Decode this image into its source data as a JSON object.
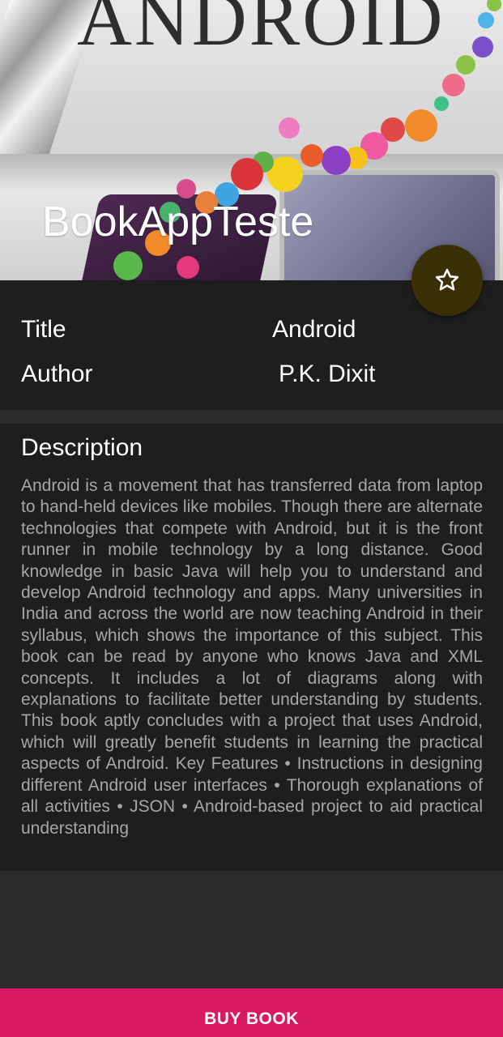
{
  "header": {
    "cover_text": "ANDROID",
    "app_title": "BookAppTeste",
    "favorite_icon": "star-outline-icon"
  },
  "book": {
    "title_label": "Title",
    "title_value": "Android",
    "author_label": "Author",
    "author_value": "P.K. Dixit"
  },
  "description": {
    "heading": "Description",
    "text": "Android is a movement that has transferred data from laptop to hand-held devices like mobiles. Though there are alternate technologies that compete with Android, but it is the front runner in mobile technology by a long distance. Good knowledge in basic Java will help you to understand and develop Android technology and apps. Many universities in India and across the world are now teaching Android in their syllabus, which shows the importance of this subject. This book can be read by anyone who knows Java and XML concepts. It includes a lot of diagrams along with explanations to facilitate better understanding by students. This book aptly concludes with a project that uses Android, which will greatly benefit students in learning the practical aspects of Android. Key Features • Instructions in designing different Android user interfaces • Thorough explanations of all activities • JSON • Android-based project to aid practical understanding"
  },
  "actions": {
    "buy_label": "BUY BOOK"
  },
  "colors": {
    "accent": "#d81b60",
    "fab": "#3a3008",
    "panel": "#1e1e1e",
    "background": "#2b2b2b"
  }
}
